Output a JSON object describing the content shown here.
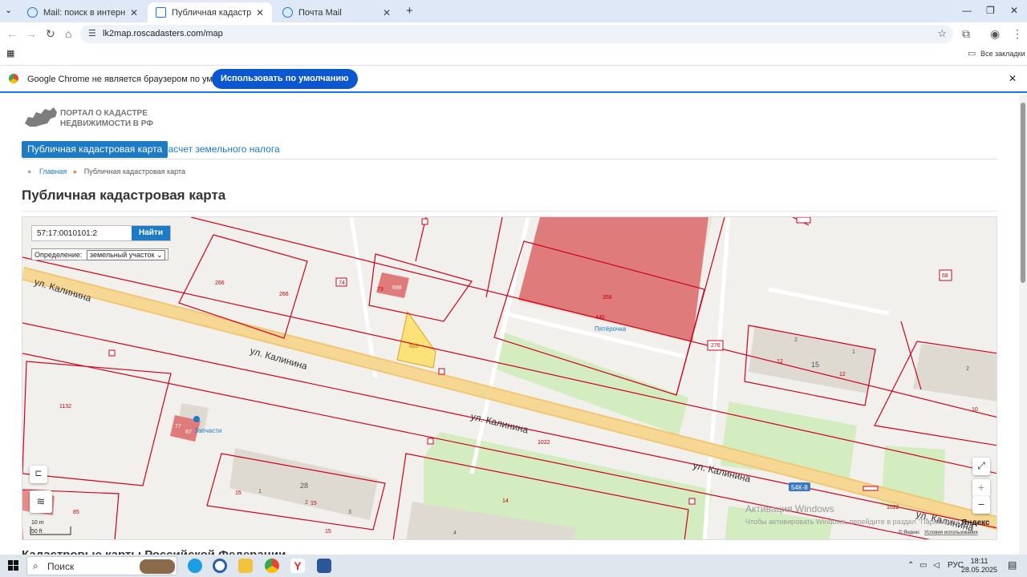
{
  "browser": {
    "tabs": [
      {
        "title": "Mail: поиск в интернете",
        "active": false
      },
      {
        "title": "Публичная кадастровая карта",
        "active": true
      },
      {
        "title": "Почта Mail",
        "active": false
      }
    ],
    "url": "lk2map.roscadasters.com/map",
    "bookmarks_label": "Все закладки",
    "infobar_message": "Google Chrome не является браузером по умолчанию.",
    "infobar_button": "Использовать по умолчанию",
    "colors": {
      "tabstrip": "#dfe8f6",
      "accent": "#1a73e8",
      "button": "#0b57d0"
    }
  },
  "page": {
    "logo_line1": "ПОРТАЛ О КАДАСТРЕ",
    "logo_line2": "НЕДВИЖИМОСТИ В РФ",
    "nav_active": "Публичная кадастровая карта",
    "nav_other": "Расчет земельного налога",
    "breadcrumb_home": "Главная",
    "breadcrumb_current": "Публичная кадастровая карта",
    "title": "Публичная кадастровая карта",
    "below_heading": "Кадастровые карты Российской Федерации",
    "colors": {
      "brand": "#1d7bc5"
    }
  },
  "map": {
    "search_value": "57:17:0010101:2",
    "search_button": "Найти",
    "definition_label": "Определение:",
    "definition_value": "земельный участок",
    "streets": [
      {
        "name": "ул. Калинина"
      },
      {
        "name": "ул. Калинина"
      },
      {
        "name": "ул. Калинина"
      },
      {
        "name": "ул. Калинина"
      },
      {
        "name": "ул. Калинина"
      }
    ],
    "labels": [
      {
        "text": "266"
      },
      {
        "text": "266"
      },
      {
        "text": "74"
      },
      {
        "text": "73"
      },
      {
        "text": "698"
      },
      {
        "text": "358"
      },
      {
        "text": "440"
      },
      {
        "text": "68"
      },
      {
        "text": "276"
      },
      {
        "text": "12"
      },
      {
        "text": "15"
      },
      {
        "text": "12"
      },
      {
        "text": "2"
      },
      {
        "text": "1"
      },
      {
        "text": "2"
      },
      {
        "text": "10"
      },
      {
        "text": "689"
      },
      {
        "text": "1132"
      },
      {
        "text": "77"
      },
      {
        "text": "87"
      },
      {
        "text": "1022"
      },
      {
        "text": "28"
      },
      {
        "text": "15"
      },
      {
        "text": "1"
      },
      {
        "text": "2"
      },
      {
        "text": "15"
      },
      {
        "text": "3"
      },
      {
        "text": "14"
      },
      {
        "text": "85"
      },
      {
        "text": "15"
      },
      {
        "text": "4"
      },
      {
        "text": "1022"
      }
    ],
    "poi_pyaterochka": "Пятёрочка",
    "poi_zapchasti": "Запчасти",
    "road_badge": "54К-8",
    "scale_10": "10 m",
    "scale_50": "50 ft",
    "yandex_label": "Яндекс",
    "copyright": "© Яндекс",
    "terms": "Условия использования",
    "watermark_title": "Активация Windows",
    "watermark_sub": "Чтобы активировать Windows, перейдите в раздел \"Параметры\".",
    "zoom_in": "+",
    "zoom_out": "−",
    "colors": {
      "parcel_fill": "#e07b7b",
      "parcel_outline": "#d0021b",
      "selected_parcel": "#fde27a",
      "road": "#f7d794",
      "green": "#d4edc0"
    }
  },
  "taskbar": {
    "search_label": "Поиск",
    "lang": "РУС",
    "time": "18:11",
    "date": "28.05.2025"
  }
}
